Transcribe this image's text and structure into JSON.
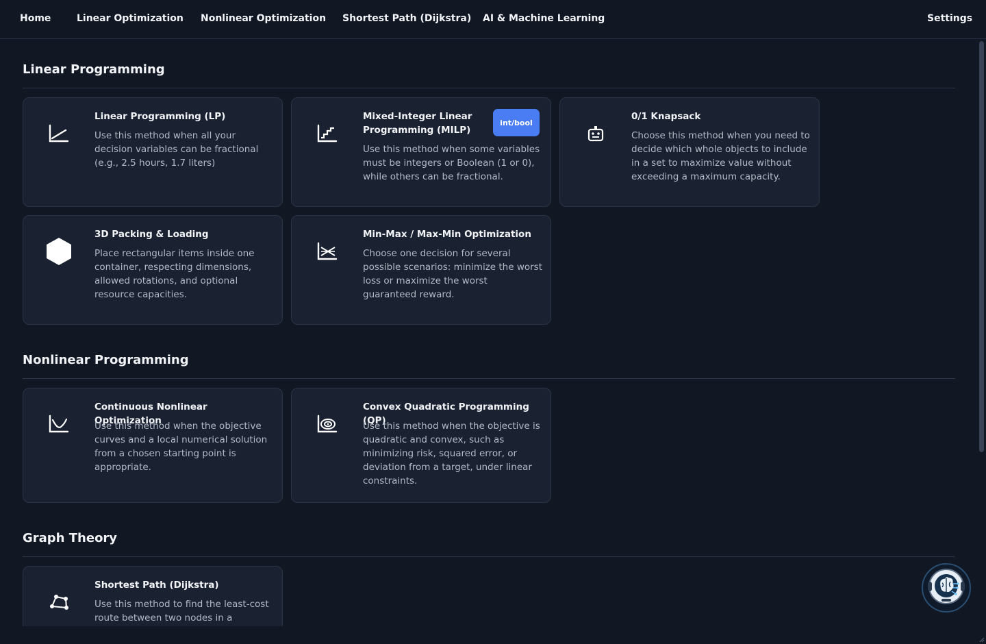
{
  "nav": {
    "items": [
      {
        "label": "Home"
      },
      {
        "label": "Linear Optimization"
      },
      {
        "label": "Nonlinear Optimization"
      },
      {
        "label": "Shortest Path (Dijkstra)"
      },
      {
        "label": "AI & Machine Learning"
      }
    ],
    "settings_label": "Settings"
  },
  "sections": [
    {
      "title": "Linear Programming",
      "cards": [
        {
          "icon": "chart-line-icon",
          "title": "Linear Programming (LP)",
          "desc": "Use this method when all your decision variables can be fractional (e.g., 2.5 hours, 1.7 liters)"
        },
        {
          "icon": "step-chart-icon",
          "title": "Mixed-Integer Linear Programming (MILP)",
          "badge": "int/bool",
          "desc": "Use this method when some variables must be integers or Boolean (1 or 0), while others can be fractional."
        },
        {
          "icon": "robot-icon",
          "title": "0/1 Knapsack",
          "desc": "Choose this method when you need to decide which whole objects to include in a set to maximize value without exceeding a maximum capacity."
        },
        {
          "icon": "hexagon-icon",
          "title": "3D Packing & Loading",
          "desc": "Place rectangular items inside one container, respecting dimensions, allowed rotations, and optional resource capacities."
        },
        {
          "icon": "minmax-chart-icon",
          "title": "Min-Max / Max-Min Optimization",
          "desc": "Choose one decision for several possible scenarios: minimize the worst loss or maximize the worst guaranteed reward."
        }
      ]
    },
    {
      "title": "Nonlinear Programming",
      "cards": [
        {
          "icon": "curve-chart-icon",
          "title": "Continuous Nonlinear Optimization",
          "desc": "Use this method when the objective curves and a local numerical solution from a chosen starting point is appropriate."
        },
        {
          "icon": "contour-chart-icon",
          "title": "Convex Quadratic Programming (QP)",
          "desc": "Use this method when the objective is quadratic and convex, such as minimizing risk, squared error, or deviation from a target, under linear constraints."
        }
      ]
    },
    {
      "title": "Graph Theory",
      "cards": [
        {
          "icon": "graph-nodes-icon",
          "title": "Shortest Path (Dijkstra)",
          "desc": "Use this method to find the least-cost route between two nodes in a"
        }
      ]
    }
  ],
  "colors": {
    "background": "#111723",
    "card": "#1a2130",
    "badge": "#4a7cf3"
  }
}
